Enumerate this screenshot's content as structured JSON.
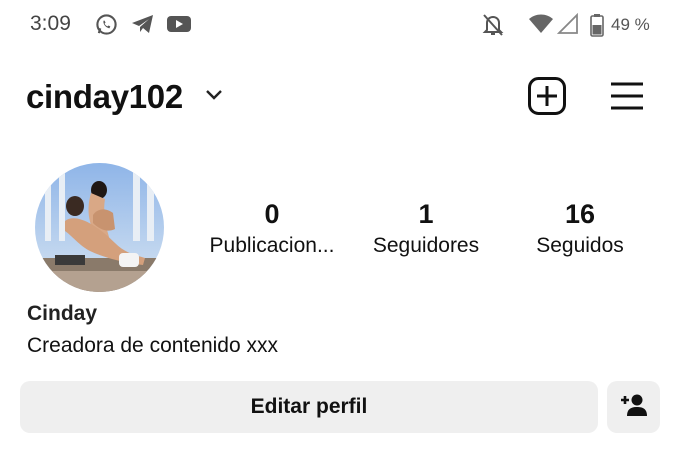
{
  "status_bar": {
    "time": "3:09",
    "apps": [
      "whatsapp-icon",
      "telegram-icon",
      "youtube-icon"
    ],
    "battery_percent": "49 %"
  },
  "header": {
    "username": "cinday102"
  },
  "profile": {
    "stats": [
      {
        "value": "0",
        "label": "Publicacion..."
      },
      {
        "value": "1",
        "label": "Seguidores"
      },
      {
        "value": "16",
        "label": "Seguidos"
      }
    ],
    "display_name": "Cinday",
    "bio": "Creadora de contenido xxx"
  },
  "actions": {
    "edit_profile_label": "Editar perfil"
  },
  "colors": {
    "button_bg": "#efefef",
    "text": "#111111"
  }
}
